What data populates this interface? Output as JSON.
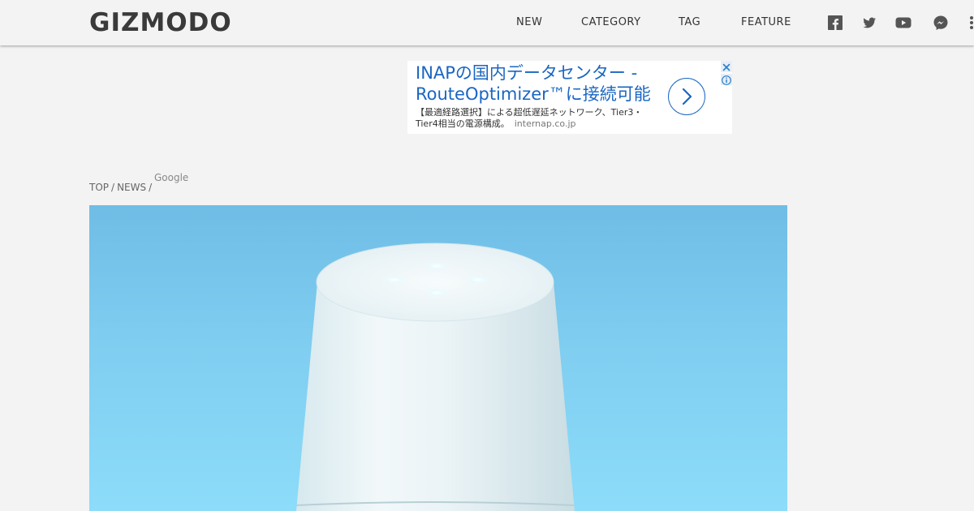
{
  "header": {
    "logo": "GIZMODO",
    "nav": [
      {
        "label": "NEW"
      },
      {
        "label": "CATEGORY"
      },
      {
        "label": "TAG"
      },
      {
        "label": "FEATURE"
      }
    ],
    "social_icons": [
      "facebook-icon",
      "twitter-icon",
      "youtube-icon",
      "messenger-icon",
      "more-icon"
    ]
  },
  "ad": {
    "headline": "INAPの国内データセンター - RouteOptimizer™に接続可能",
    "description": "【最適経路選択】による超低遅延ネットワーク、Tier3・Tier4相当の電源構成。",
    "domain": "internap.co.jp",
    "accent_color": "#1a66c2"
  },
  "breadcrumb": {
    "items": [
      "TOP",
      "NEWS"
    ],
    "separator": "/",
    "tag": "Google"
  },
  "hero": {
    "background_color": "#7fcdf0"
  }
}
